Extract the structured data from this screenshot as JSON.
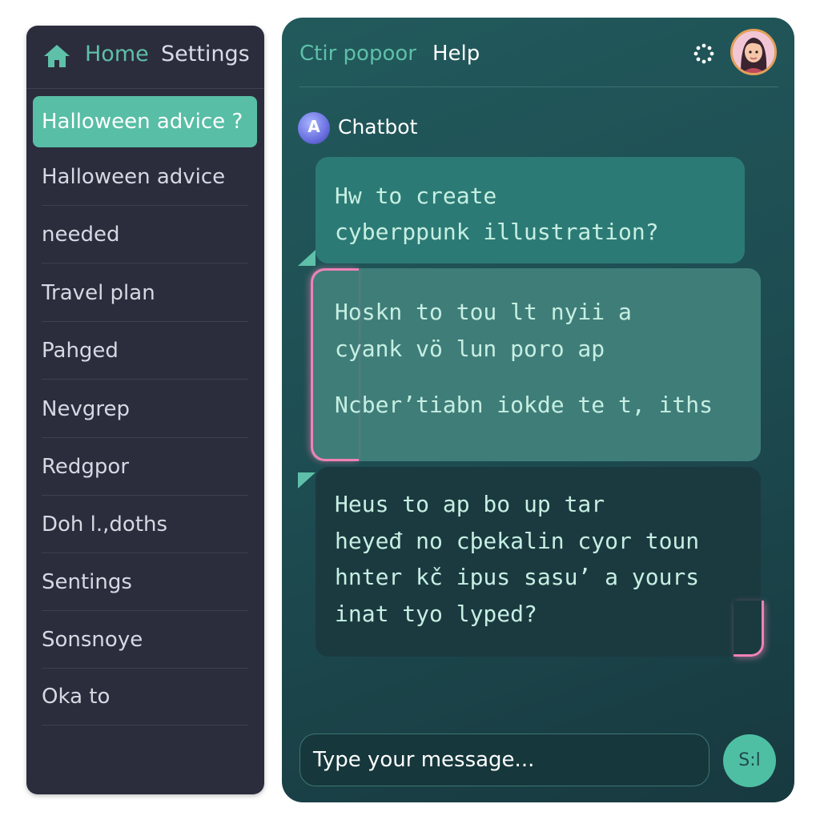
{
  "sidebar": {
    "home_label": "Home",
    "settings_label": "Settings",
    "items": [
      {
        "label": "Halloween advice ?",
        "active": true
      },
      {
        "label": "Halloween advice",
        "active": false
      },
      {
        "label": "needed",
        "active": false
      },
      {
        "label": "Travel plan",
        "active": false
      },
      {
        "label": "Pahged",
        "active": false
      },
      {
        "label": "Nevgrep",
        "active": false
      },
      {
        "label": "Redgpor",
        "active": false
      },
      {
        "label": "Doh l.,doths",
        "active": false
      },
      {
        "label": "Sentings",
        "active": false
      },
      {
        "label": "Sonsnoye",
        "active": false
      },
      {
        "label": "Oka to",
        "active": false
      }
    ]
  },
  "chat": {
    "tab_primary": "Ctir popoor",
    "tab_help": "Help",
    "bot_label": "Chatbot",
    "bot_icon_letter": "A",
    "messages": [
      {
        "lines": [
          "Hw to create",
          "cyberppunk  illustration?"
        ]
      },
      {
        "lines": [
          "Hoskn to tou lt nyii a",
          "cyank vö lun poro  ap",
          "Ncber’tiabn  iokde te t, iths"
        ]
      },
      {
        "lines": [
          "Heus to ap bo up tar",
          "heyeđ no cþekalin cyor toun",
          "hnter kč ipus sasu’ a yours",
          "inat tyo lyped?"
        ]
      }
    ],
    "input_placeholder": "Type your message...",
    "send_label": "S:l"
  },
  "colors": {
    "accent": "#58bea6",
    "sidebar_bg": "#2b2d3d",
    "highlight_pink": "#ef82b6"
  },
  "icons": {
    "home": "home-icon",
    "dots": "loading-dots-icon",
    "bot": "chatbot-icon",
    "avatar": "user-avatar"
  }
}
